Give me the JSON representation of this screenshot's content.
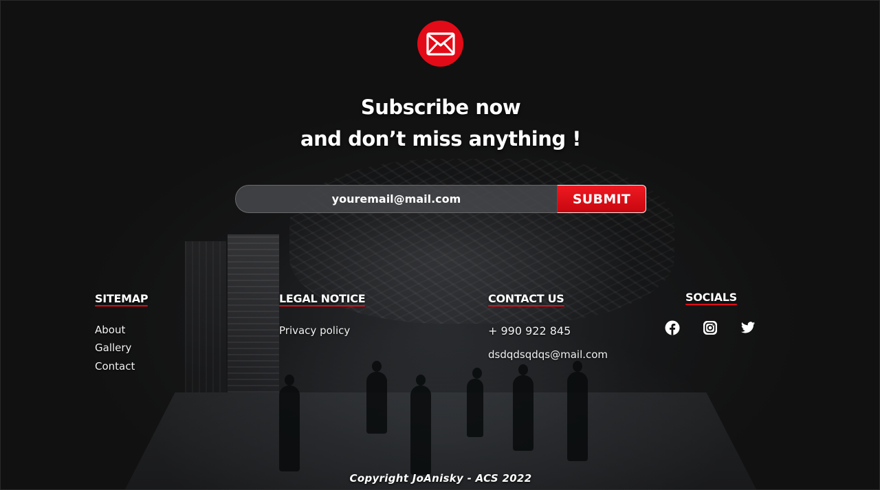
{
  "header": {
    "icon": "mail-icon",
    "headline_line1": "Subscribe now",
    "headline_line2": "and don’t miss anything !"
  },
  "subscribe_form": {
    "email_placeholder": "youremail@mail.com",
    "submit_label": "SUBMIT"
  },
  "footer": {
    "sitemap": {
      "title": "SITEMAP",
      "links": [
        "About",
        "Gallery",
        "Contact"
      ]
    },
    "legal": {
      "title": "LEGAL NOTICE",
      "links": [
        "Privacy policy"
      ]
    },
    "contact": {
      "title": "CONTACT US",
      "phone": "+ 990 922 845",
      "email": "dsdqdsqdqs@mail.com"
    },
    "socials": {
      "title": "SOCIALS",
      "icons": [
        "facebook-icon",
        "instagram-icon",
        "twitter-icon"
      ]
    },
    "copyright": "Copyright JoAnisky - ACS 2022"
  },
  "colors": {
    "accent": "#e30b17",
    "background": "#111111",
    "text": "#ffffff"
  }
}
